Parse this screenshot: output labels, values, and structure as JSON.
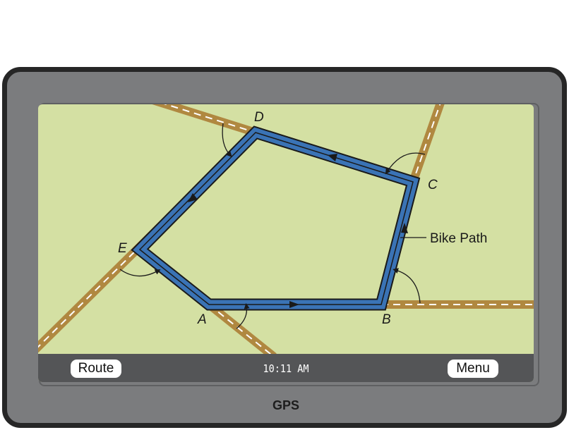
{
  "vertices": {
    "a": "A",
    "b": "B",
    "c": "C",
    "d": "D",
    "e": "E"
  },
  "callout": {
    "bike_path": "Bike Path"
  },
  "toolbar": {
    "route_label": "Route",
    "menu_label": "Menu",
    "clock": "10:11 AM"
  },
  "device": {
    "brand": "GPS"
  },
  "colors": {
    "map_background": "#d4e0a3",
    "road": "#b08840",
    "bike_path": "#3a73b5",
    "bezel": "#7b7c7e"
  }
}
